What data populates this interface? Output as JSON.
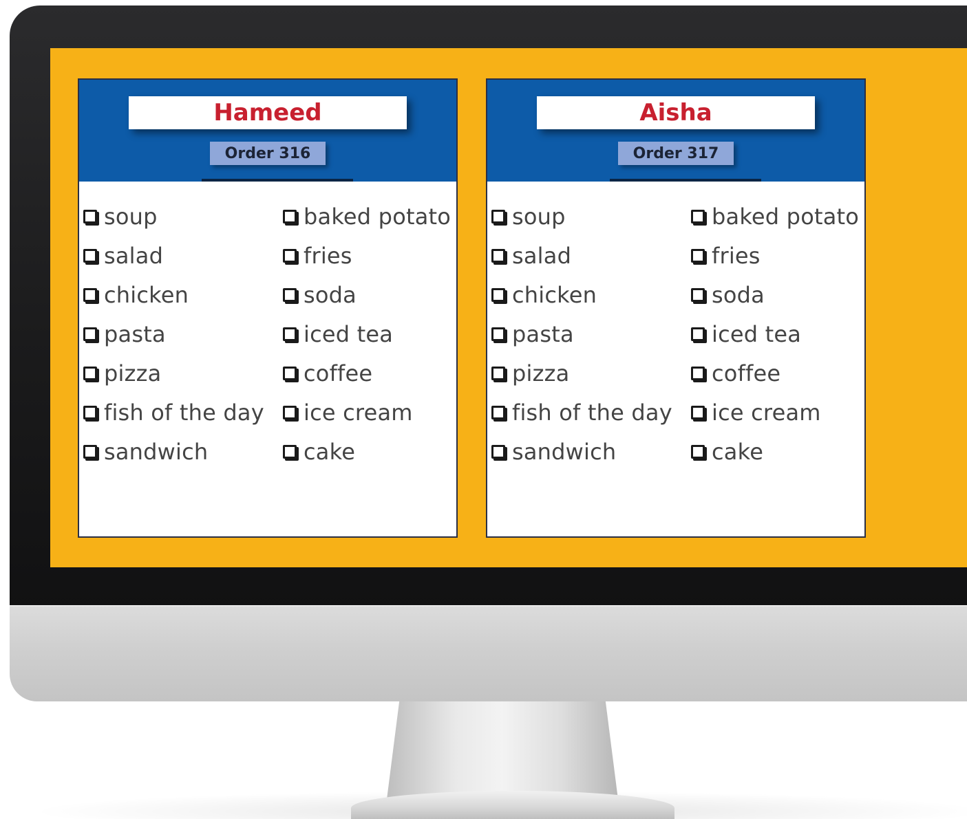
{
  "colors": {
    "screen_background": "#f7b117",
    "header_blue": "#0d5ba8",
    "name_red": "#c8202f",
    "badge_blue": "#8fa7d9"
  },
  "orders": [
    {
      "name": "Hameed",
      "order_label": "Order 316",
      "items_col1": [
        "soup",
        "salad",
        "chicken",
        "pasta",
        "pizza",
        "fish of the day",
        "sandwich"
      ],
      "items_col2": [
        "baked potato",
        "fries",
        "soda",
        "iced tea",
        "coffee",
        "ice cream",
        "cake"
      ]
    },
    {
      "name": "Aisha",
      "order_label": "Order 317",
      "items_col1": [
        "soup",
        "salad",
        "chicken",
        "pasta",
        "pizza",
        "fish of the day",
        "sandwich"
      ],
      "items_col2": [
        "baked potato",
        "fries",
        "soda",
        "iced tea",
        "coffee",
        "ice cream",
        "cake"
      ]
    }
  ]
}
